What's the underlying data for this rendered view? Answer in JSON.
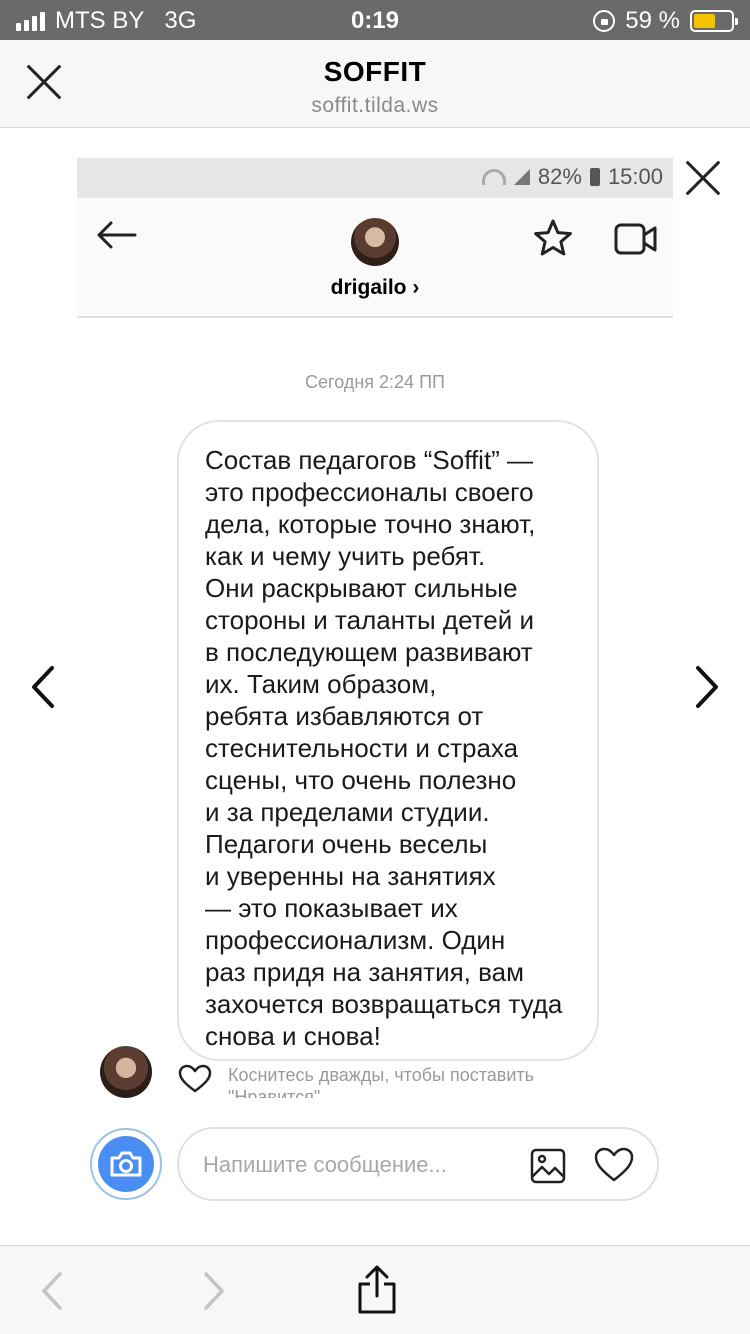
{
  "status_bar": {
    "carrier": "MTS BY",
    "network": "3G",
    "time": "0:19",
    "battery_percent": "59 %",
    "battery_level": 0.59,
    "battery_color": "#f5c400"
  },
  "browser": {
    "title": "SOFFIT",
    "url": "soffit.tilda.ws",
    "close_icon": "close-x-icon"
  },
  "embedded_screenshot": {
    "status": {
      "battery": "82%",
      "time": "15:00"
    },
    "header": {
      "username": "drigailo",
      "username_chevron": "›",
      "icons": [
        "back-arrow-icon",
        "star-icon",
        "video-camera-icon"
      ]
    },
    "timestamp": "Сегодня 2:24 ПП",
    "message": "Состав педагогов “Soffit” —\nэто профессионалы своего\nдела, которые точно знают,\nкак и чему учить ребят.\nОни раскрывают сильные\nстороны и таланты детей и\nв последующем развивают\nих. Таким образом,\nребята избавляются от\nстеснительности и страха\nсцены, что очень полезно\nи за пределами студии.\nПедагоги очень веселы\nи уверенны на занятиях\n— это показывает их\nпрофессионализм. Один\nраз придя на занятия, вам\nзахочется возвращаться туда\nснова и снова!",
    "like_hint": "Коснитесь дважды, чтобы поставить \"Нравится\"",
    "composer": {
      "placeholder": "Напишите сообщение..."
    }
  },
  "colors": {
    "accent_blue": "#4b8ef3",
    "status_bar_bg": "#6a6a6a",
    "toolbar_bg": "#f7f7f7"
  }
}
